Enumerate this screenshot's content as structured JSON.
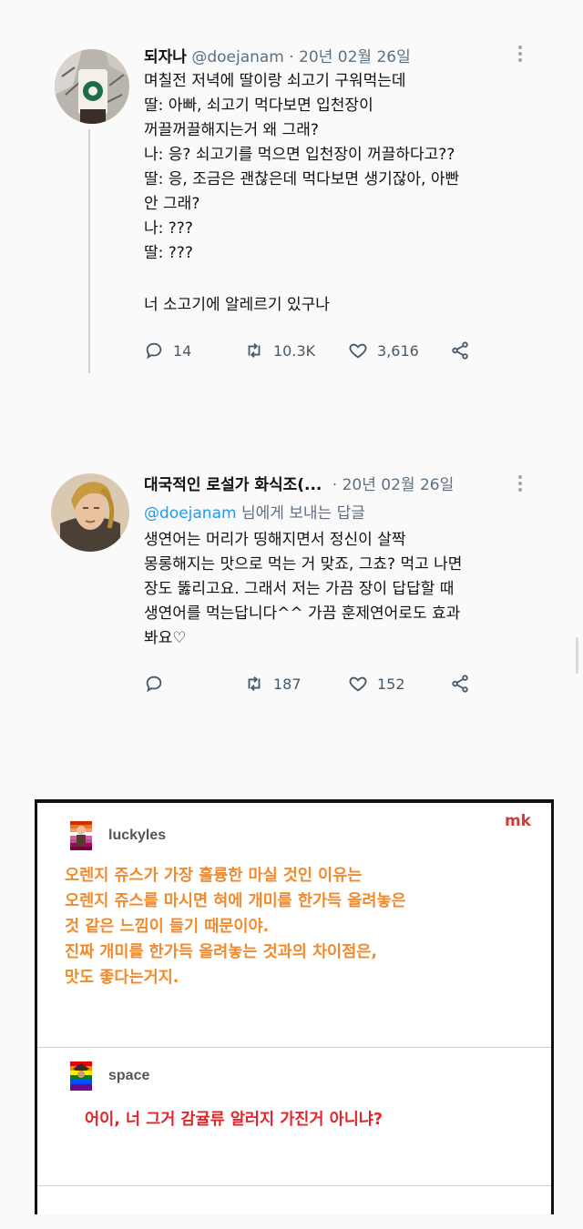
{
  "tweets": [
    {
      "name": "되자나",
      "handle": "@doejanam",
      "date": "· 20년 02월 26일",
      "lines": [
        "며칠전 저녁에 딸이랑 쇠고기 구워먹는데",
        "딸: 아빠, 쇠고기 먹다보면 입천장이",
        "꺼끌꺼끌해지는거 왜 그래?",
        "나: 응? 쇠고기를 먹으면 입천장이 꺼끌하다고??",
        "딸: 응, 조금은 괜찮은데 먹다보면 생기잖아, 아빤",
        "안 그래?",
        "나: ???",
        "딸: ???",
        "",
        "너 소고기에 알레르기 있구나"
      ],
      "replies": "14",
      "retweets": "10.3K",
      "likes": "3,616"
    },
    {
      "name": "대국적인 로설가 화식조(...",
      "date": "· 20년 02월 26일",
      "reply_mention": "@doejanam",
      "reply_suffix": " 님에게 보내는 답글",
      "lines": [
        "생연어는 머리가 띵해지면서 정신이 살짝",
        "몽롱해지는 맛으로 먹는 거 맞죠, 그쵸? 먹고 나면",
        "장도 뚫리고요. 그래서 저는 가끔 장이 답답할 때",
        "생연어를 먹는답니다^^ 가끔 훈제연어로도 효과",
        "봐요♡"
      ],
      "replies": "",
      "retweets": "187",
      "likes": "152"
    }
  ],
  "panel": {
    "watermark": "mk",
    "post1": {
      "username": "luckyles",
      "lines": [
        "오렌지 쥬스가 가장 훌륭한 마실 것인 이유는",
        "오렌지 쥬스를 마시면 혀에 개미를 한가득 올려놓은",
        "것 같은 느낌이 들기 때문이야.",
        "진짜 개미를 한가득 올려놓는 것과의 차이점은,",
        "맛도 좋다는거지."
      ]
    },
    "post2": {
      "username": "space",
      "text": "어이, 너 그거 감귤류 알러지 가진거 아니냐?"
    }
  },
  "colors": {
    "mention": "#1d9bf0",
    "orange_text": "#f08a2c",
    "red_text": "#e1252b",
    "icon_gray": "#4a5966"
  }
}
